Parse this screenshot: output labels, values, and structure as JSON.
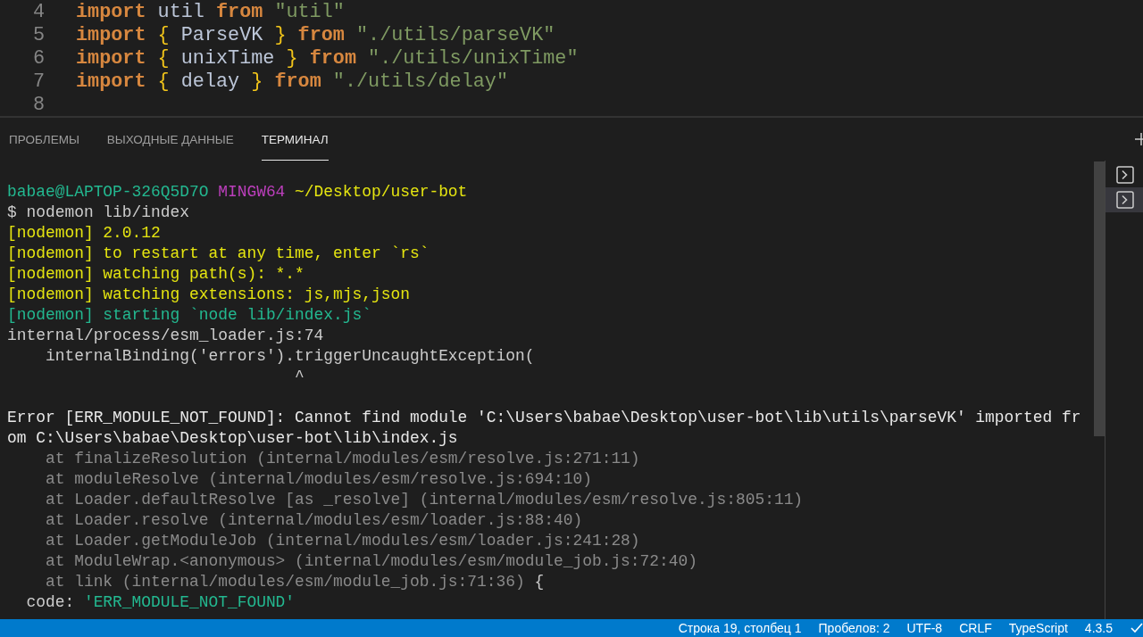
{
  "editor": {
    "lines": [
      {
        "number": "4",
        "tokens": [
          {
            "kind": "keyword",
            "text": "import"
          },
          {
            "kind": "plain",
            "text": " util "
          },
          {
            "kind": "keyword",
            "text": "from"
          },
          {
            "kind": "string",
            "text": " \"util\""
          }
        ]
      },
      {
        "number": "5",
        "tokens": [
          {
            "kind": "keyword",
            "text": "import"
          },
          {
            "kind": "brace",
            "text": " {"
          },
          {
            "kind": "plain",
            "text": " ParseVK "
          },
          {
            "kind": "brace",
            "text": "}"
          },
          {
            "kind": "keyword",
            "text": " from"
          },
          {
            "kind": "string",
            "text": " \"./utils/parseVK\""
          }
        ]
      },
      {
        "number": "6",
        "tokens": [
          {
            "kind": "keyword",
            "text": "import"
          },
          {
            "kind": "brace",
            "text": " {"
          },
          {
            "kind": "plain",
            "text": " unixTime "
          },
          {
            "kind": "brace",
            "text": "}"
          },
          {
            "kind": "keyword",
            "text": " from"
          },
          {
            "kind": "string",
            "text": " \"./utils/unixTime\""
          }
        ]
      },
      {
        "number": "7",
        "tokens": [
          {
            "kind": "keyword",
            "text": "import"
          },
          {
            "kind": "brace",
            "text": " {"
          },
          {
            "kind": "plain",
            "text": " delay "
          },
          {
            "kind": "brace",
            "text": "}"
          },
          {
            "kind": "keyword",
            "text": " from"
          },
          {
            "kind": "string",
            "text": " \"./utils/delay\""
          }
        ]
      },
      {
        "number": "8"
      }
    ]
  },
  "panel_tabs": [
    {
      "label": "ПРОБЛЕМЫ",
      "selected": false
    },
    {
      "label": "ВЫХОДНЫЕ ДАННЫЕ",
      "selected": false
    },
    {
      "label": "ТЕРМИНАЛ",
      "selected": true
    }
  ],
  "terminal": {
    "lines": [
      {
        "segments": [
          {
            "kind": "user",
            "text": "babae@LAPTOP-326Q5D7O"
          },
          {
            "kind": "host",
            "text": " MINGW64"
          },
          {
            "kind": "path",
            "text": " ~/Desktop/user-bot"
          }
        ]
      },
      {
        "segments": [
          {
            "kind": "plain",
            "text": "$ nodemon lib/index"
          }
        ]
      },
      {
        "segments": [
          {
            "kind": "warn",
            "text": "[nodemon] 2.0.12"
          }
        ]
      },
      {
        "segments": [
          {
            "kind": "warn",
            "text": "[nodemon] to restart at any time, enter `rs`"
          }
        ]
      },
      {
        "segments": [
          {
            "kind": "warn",
            "text": "[nodemon] watching path(s): *.*"
          }
        ]
      },
      {
        "segments": [
          {
            "kind": "warn",
            "text": "[nodemon] watching extensions: js,mjs,json"
          }
        ]
      },
      {
        "segments": [
          {
            "kind": "info",
            "text": "[nodemon] starting `node lib/index.js`"
          }
        ]
      },
      {
        "segments": [
          {
            "kind": "plain",
            "text": "internal/process/esm_loader.js:74"
          }
        ]
      },
      {
        "segments": [
          {
            "kind": "plain",
            "text": "    internalBinding('errors').triggerUncaughtException("
          }
        ]
      },
      {
        "segments": [
          {
            "kind": "plain",
            "text": "                              ^"
          }
        ]
      },
      {
        "blank_before": true,
        "segments": [
          {
            "kind": "error",
            "text": "Error [ERR_MODULE_NOT_FOUND]: Cannot find module 'C:\\Users\\babae\\Desktop\\user-bot\\lib\\utils\\parseVK' imported fr"
          }
        ]
      },
      {
        "segments": [
          {
            "kind": "error",
            "text": "om C:\\Users\\babae\\Desktop\\user-bot\\lib\\index.js"
          }
        ]
      },
      {
        "segments": [
          {
            "kind": "trace",
            "text": "    at finalizeResolution (internal/modules/esm/resolve.js:271:11)"
          }
        ]
      },
      {
        "segments": [
          {
            "kind": "trace",
            "text": "    at moduleResolve (internal/modules/esm/resolve.js:694:10)"
          }
        ]
      },
      {
        "segments": [
          {
            "kind": "trace",
            "text": "    at Loader.defaultResolve [as _resolve] (internal/modules/esm/resolve.js:805:11)"
          }
        ]
      },
      {
        "segments": [
          {
            "kind": "trace",
            "text": "    at Loader.resolve (internal/modules/esm/loader.js:88:40)"
          }
        ]
      },
      {
        "segments": [
          {
            "kind": "trace",
            "text": "    at Loader.getModuleJob (internal/modules/esm/loader.js:241:28)"
          }
        ]
      },
      {
        "segments": [
          {
            "kind": "trace",
            "text": "    at ModuleWrap.<anonymous> (internal/modules/esm/module_job.js:72:40)"
          }
        ]
      },
      {
        "segments": [
          {
            "kind": "trace",
            "text": "    at link (internal/modules/esm/module_job.js:71:36)"
          },
          {
            "kind": "plain",
            "text": " {"
          }
        ]
      },
      {
        "segments": [
          {
            "kind": "plain",
            "text": "  code: "
          },
          {
            "kind": "info",
            "text": "'ERR_MODULE_NOT_FOUND'"
          }
        ]
      }
    ]
  },
  "terminal_list": [
    {
      "selected": false
    },
    {
      "selected": true
    }
  ],
  "status_bar": [
    {
      "text": "Строка 19, столбец 1"
    },
    {
      "text": "Пробелов: 2"
    },
    {
      "text": "UTF-8"
    },
    {
      "text": "CRLF"
    },
    {
      "text": "TypeScript"
    },
    {
      "text": "4.3.5"
    }
  ]
}
